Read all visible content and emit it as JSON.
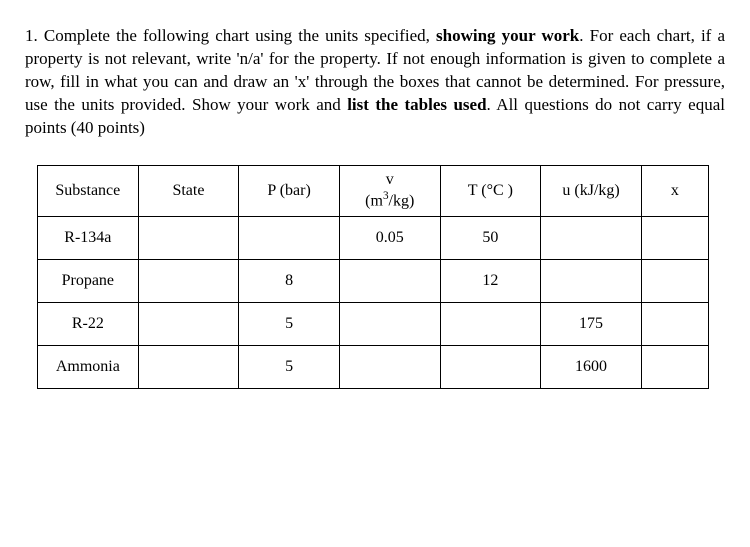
{
  "problem": {
    "number": "1.",
    "text_part1": "Complete the following chart using the units specified, ",
    "bold1": "showing your work",
    "text_part2": ".  For each chart, if a property is not relevant, write 'n/a' for the property.   If not enough information is given to complete a row, fill in what you can and draw an 'x' through the boxes that cannot be determined.  For pressure, use the units provided.  Show your work and ",
    "bold2": "list the tables used",
    "text_part3": ".  All questions do not carry equal points (40 points)"
  },
  "table": {
    "headers": {
      "substance": "Substance",
      "state": "State",
      "p": "P (bar)",
      "v_symbol": "v",
      "v_unit_prefix": "(m",
      "v_unit_sup": "3",
      "v_unit_suffix": "/kg)",
      "t": "T (°C )",
      "u": "u (kJ/kg)",
      "x": "x"
    },
    "rows": [
      {
        "substance": "R-134a",
        "state": "",
        "p": "",
        "v": "0.05",
        "t": "50",
        "u": "",
        "x": ""
      },
      {
        "substance": "Propane",
        "state": "",
        "p": "8",
        "v": "",
        "t": "12",
        "u": "",
        "x": ""
      },
      {
        "substance": "R-22",
        "state": "",
        "p": "5",
        "v": "",
        "t": "",
        "u": "175",
        "x": ""
      },
      {
        "substance": "Ammonia",
        "state": "",
        "p": "5",
        "v": "",
        "t": "",
        "u": "1600",
        "x": ""
      }
    ]
  },
  "chart_data": {
    "type": "table",
    "columns": [
      "Substance",
      "State",
      "P (bar)",
      "v (m3/kg)",
      "T (°C)",
      "u (kJ/kg)",
      "x"
    ],
    "rows": [
      [
        "R-134a",
        "",
        "",
        "0.05",
        "50",
        "",
        ""
      ],
      [
        "Propane",
        "",
        "8",
        "",
        "12",
        "",
        ""
      ],
      [
        "R-22",
        "",
        "5",
        "",
        "",
        "175",
        ""
      ],
      [
        "Ammonia",
        "",
        "5",
        "",
        "",
        "1600",
        ""
      ]
    ]
  }
}
